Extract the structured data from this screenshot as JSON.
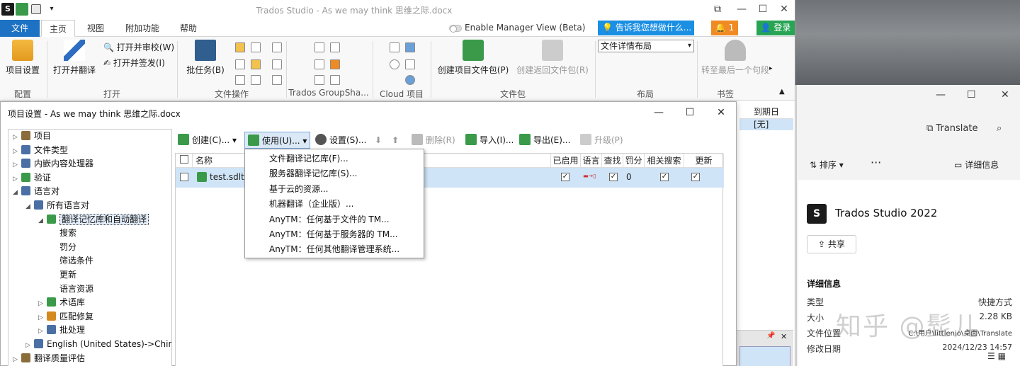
{
  "window": {
    "title": "Trados Studio - As we may think 思维之际.docx",
    "ctl_restore": "⧉",
    "ctl_min": "—",
    "ctl_max": "☐",
    "ctl_close": "✕"
  },
  "ribbon": {
    "tabs": [
      "文件",
      "主页",
      "视图",
      "附加功能",
      "帮助"
    ],
    "manager_view": "Enable Manager View (Beta)",
    "tell_me": "告诉我您想做什么...",
    "notifications": "1",
    "login": "登录",
    "groups": {
      "config": {
        "label": "配置",
        "project_settings": "项目设置"
      },
      "open": {
        "label": "打开",
        "open_translate": "打开并翻译",
        "open_review": "打开并审校(W)",
        "open_signoff": "打开并签发(I)"
      },
      "file_ops": {
        "label": "文件操作",
        "batch_tasks": "批任务(B)"
      },
      "groupshare": {
        "label": "Trados GroupSha..."
      },
      "cloud": {
        "label": "Cloud 项目"
      },
      "package": {
        "label": "文件包",
        "create_pkg": "创建项目文件包(P)",
        "create_return": "创建返回文件包(R)"
      },
      "layout": {
        "label": "布局",
        "select_value": "文件详情布局"
      },
      "bookmarks": {
        "label": "书签",
        "goto_last": "转至最后一个句段"
      }
    }
  },
  "background_grid": {
    "due_header": "到期日",
    "due_value": "[无]"
  },
  "dialog": {
    "title": "项目设置 - As we may think 思维之际.docx",
    "tree": [
      {
        "label": "项目",
        "indent": 0,
        "exp": "▷",
        "color": "#8a6d3b"
      },
      {
        "label": "文件类型",
        "indent": 0,
        "exp": "▷",
        "color": "#4a6fa5"
      },
      {
        "label": "内嵌内容处理器",
        "indent": 0,
        "exp": "▷",
        "color": "#4a6fa5"
      },
      {
        "label": "验证",
        "indent": 0,
        "exp": "▷",
        "color": "#3a9a4a"
      },
      {
        "label": "语言对",
        "indent": 0,
        "exp": "◢",
        "color": "#4a6fa5"
      },
      {
        "label": "所有语言对",
        "indent": 1,
        "exp": "◢",
        "color": "#4a6fa5"
      },
      {
        "label": "翻译记忆库和自动翻译",
        "indent": 2,
        "exp": "◢",
        "color": "#3a9a4a",
        "selected": true
      },
      {
        "label": "搜索",
        "indent": 3,
        "exp": "",
        "color": ""
      },
      {
        "label": "罚分",
        "indent": 3,
        "exp": "",
        "color": ""
      },
      {
        "label": "筛选条件",
        "indent": 3,
        "exp": "",
        "color": ""
      },
      {
        "label": "更新",
        "indent": 3,
        "exp": "",
        "color": ""
      },
      {
        "label": "语言资源",
        "indent": 3,
        "exp": "",
        "color": ""
      },
      {
        "label": "术语库",
        "indent": 2,
        "exp": "▷",
        "color": "#3a9a4a"
      },
      {
        "label": "匹配修复",
        "indent": 2,
        "exp": "▷",
        "color": "#d48a1e"
      },
      {
        "label": "批处理",
        "indent": 2,
        "exp": "▷",
        "color": "#4a6fa5"
      },
      {
        "label": "English (United States)->Chinese (",
        "indent": 1,
        "exp": "▷",
        "color": "#4a6fa5"
      },
      {
        "label": "翻译质量评估",
        "indent": 0,
        "exp": "▷",
        "color": "#8a6d3b"
      }
    ],
    "toolbar": {
      "create": "创建(C)...",
      "use": "使用(U)...",
      "settings": "设置(S)...",
      "delete": "删除(R)",
      "import": "导入(I)...",
      "export": "导出(E)...",
      "upgrade": "升级(P)"
    },
    "grid": {
      "headers": [
        "名称",
        "已启用",
        "语言",
        "查找",
        "罚分",
        "相关搜索",
        "更新"
      ],
      "row": {
        "name": "test.sdltm",
        "enabled": "✓",
        "language": "▬→▯",
        "lookup": "✓",
        "penalty": "0",
        "concordance": "✓",
        "update": "✓"
      }
    },
    "use_menu": [
      "文件翻译记忆库(F)...",
      "服务器翻译记忆库(S)...",
      "基于云的资源...",
      "机器翻译（企业版）...",
      "AnyTM：任何基于文件的 TM...",
      "AnyTM：任何基于服务器的 TM...",
      "AnyTM：任何其他翻译管理系统..."
    ]
  },
  "info_pane": {
    "translate": "Translate",
    "sort": "排序",
    "more": "···",
    "details_btn": "详细信息",
    "app_name": "Trados Studio 2022",
    "app_icon_letter": "S",
    "share": "共享",
    "details_heading": "详细信息",
    "rows": [
      {
        "k": "类型",
        "v": "快捷方式"
      },
      {
        "k": "大小",
        "v": "2.28 KB"
      },
      {
        "k": "文件位置",
        "v": "C:\\用户\\littlenio\\桌面\\Translate"
      },
      {
        "k": "修改日期",
        "v": "2024/12/23 14:57"
      }
    ],
    "watermark": "知乎 @髭儿"
  },
  "colors": {
    "accent": "#1e72c4",
    "selection": "#cfe4f7",
    "notify": "#f08a24",
    "login": "#27a454"
  }
}
